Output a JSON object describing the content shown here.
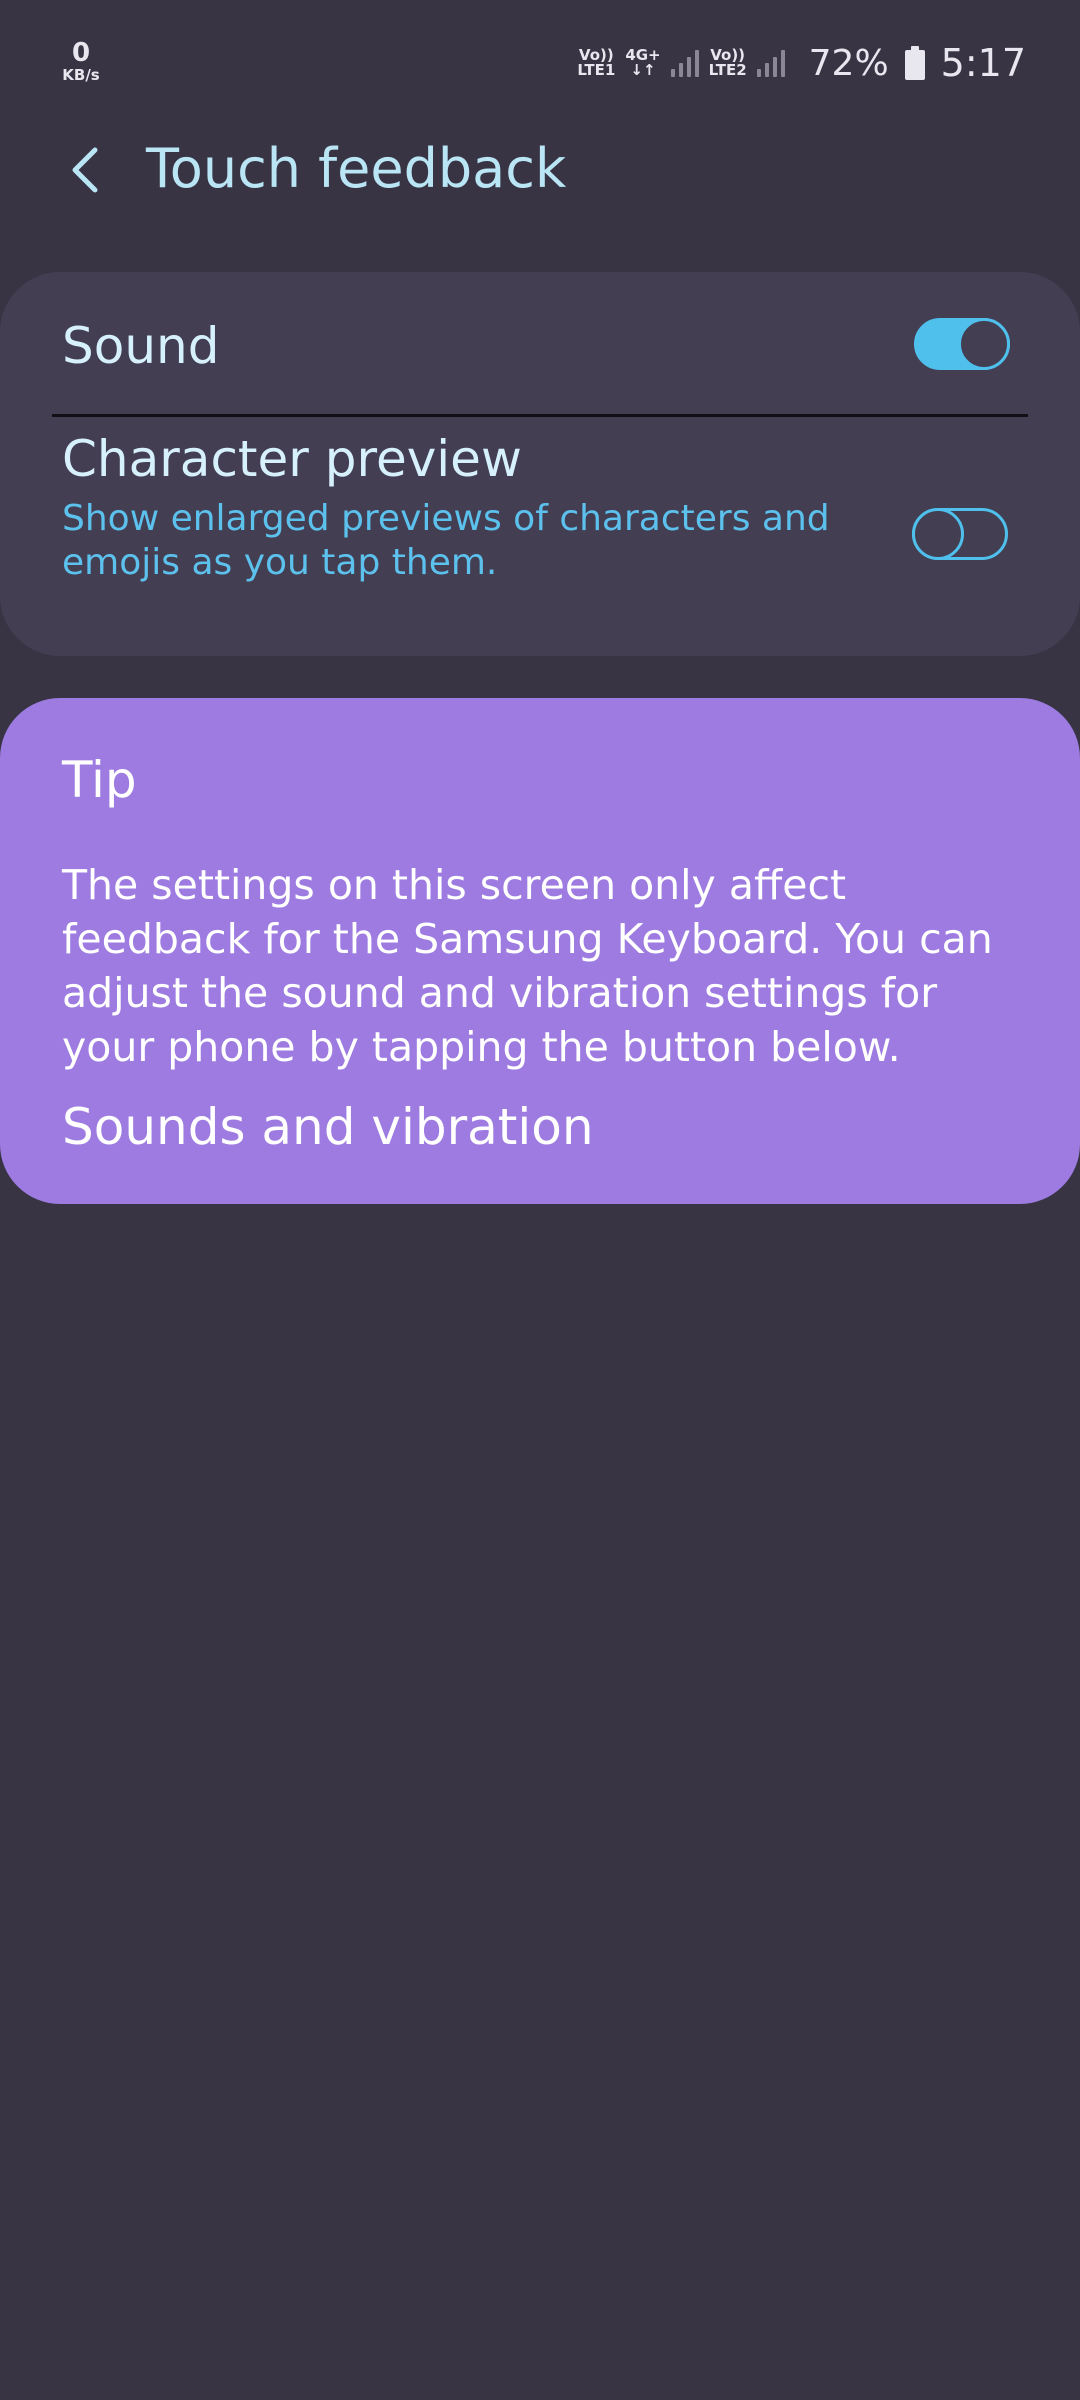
{
  "status_bar": {
    "net_speed_value": "0",
    "net_speed_unit": "KB/s",
    "sim1_top": "Vo))",
    "sim1_bottom": "LTE1",
    "net_type_top": "4G+",
    "net_type_bottom": "↓↑",
    "sim2_top": "Vo))",
    "sim2_bottom": "LTE2",
    "battery": "72%",
    "time": "5:17"
  },
  "header": {
    "back_icon": "chevron-left-icon",
    "title": "Touch feedback"
  },
  "settings": {
    "sound": {
      "label": "Sound",
      "enabled": true
    },
    "character_preview": {
      "label": "Character preview",
      "description": "Show enlarged previews of characters and emojis as you tap them.",
      "enabled": false
    }
  },
  "tip": {
    "title": "Tip",
    "body": "The settings on this screen only affect feedback for the Samsung Keyboard. You can adjust the sound and vibration settings for your phone by tapping the button below.",
    "link_label": "Sounds and vibration"
  },
  "colors": {
    "background": "#383444",
    "card": "#433e52",
    "accent": "#4fc0ec",
    "title_text": "#b9e5f5",
    "tip_background": "#9d7be0"
  }
}
